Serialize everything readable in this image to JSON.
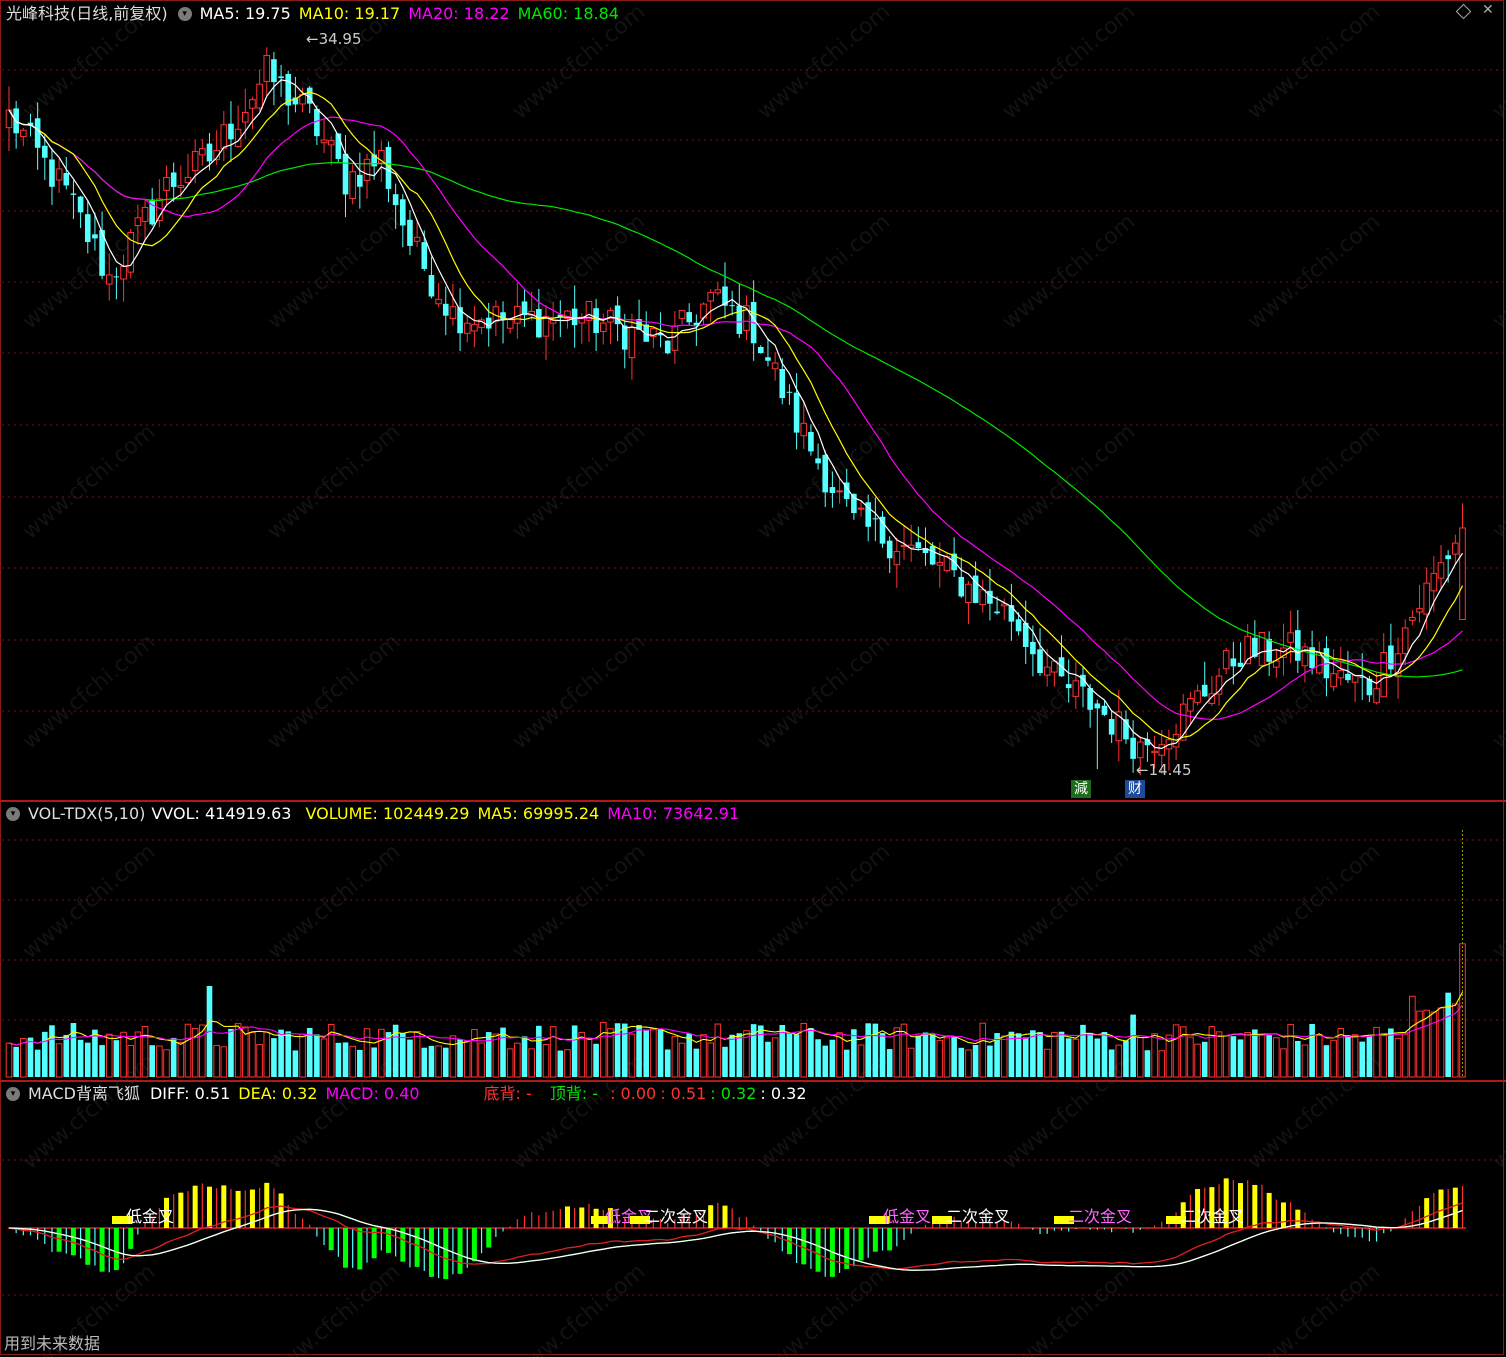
{
  "main_header": {
    "stock": "光峰科技(日线,前复权)",
    "ma5": "MA5: 19.75",
    "ma10": "MA10: 19.17",
    "ma20": "MA20: 18.22",
    "ma60": "MA60: 18.84"
  },
  "markers": {
    "high": "34.95",
    "low": "14.45",
    "tag1": "減",
    "tag2": "财"
  },
  "vol_header": {
    "name": "VOL-TDX(5,10)",
    "vvol": "VVOL: 414919.63",
    "volume": "VOLUME: 102449.29",
    "ma5": "MA5: 69995.24",
    "ma10": "MA10: 73642.91"
  },
  "macd_header": {
    "name": "MACD背离飞狐",
    "diff": "DIFF: 0.51",
    "dea": "DEA: 0.32",
    "macd": "MACD: 0.40",
    "bottom_div": "底背: -",
    "top_div": "顶背: -",
    "v1": ": 0.00",
    "v2": ": 0.51",
    "v3": ": 0.32",
    "v4": ": 0.32"
  },
  "macd_labels": [
    "低金叉",
    "低金叉",
    "二次金叉",
    "低金叉",
    "二次金叉",
    "二次金叉",
    "二次金叉"
  ],
  "footer": "用到未来数据",
  "colors": {
    "up": "#ff3232",
    "down": "#54ffff",
    "ma5": "#ffffff",
    "ma10": "#ffff00",
    "ma20": "#ff00ff",
    "ma60": "#00e600",
    "grid": "#7a1010"
  },
  "chart_data": [
    {
      "type": "candlestick",
      "title": "光峰科技(日线,前复权)",
      "ylim": [
        14.0,
        35.5
      ],
      "annotations": [
        {
          "label": "34.95",
          "kind": "high"
        },
        {
          "label": "14.45",
          "kind": "low"
        }
      ],
      "anchors": [
        [
          0,
          33.0
        ],
        [
          8,
          30.8
        ],
        [
          14,
          28.4
        ],
        [
          22,
          31.0
        ],
        [
          28,
          31.8
        ],
        [
          36,
          34.2
        ],
        [
          42,
          33.0
        ],
        [
          47,
          31.2
        ],
        [
          52,
          31.8
        ],
        [
          56,
          29.4
        ],
        [
          62,
          27.4
        ],
        [
          70,
          27.2
        ],
        [
          80,
          27.3
        ],
        [
          92,
          26.5
        ],
        [
          98,
          27.8
        ],
        [
          104,
          27.0
        ],
        [
          110,
          24.3
        ],
        [
          118,
          21.4
        ],
        [
          124,
          20.9
        ],
        [
          132,
          19.9
        ],
        [
          140,
          18.8
        ],
        [
          146,
          17.0
        ],
        [
          152,
          16.2
        ],
        [
          158,
          15.1
        ],
        [
          164,
          16.0
        ],
        [
          172,
          17.8
        ],
        [
          180,
          17.8
        ],
        [
          186,
          17.0
        ],
        [
          190,
          16.8
        ],
        [
          196,
          18.8
        ],
        [
          203,
          21.3
        ]
      ],
      "series": [
        {
          "name": "MA5",
          "value": 19.75
        },
        {
          "name": "MA10",
          "value": 19.17
        },
        {
          "name": "MA20",
          "value": 18.22
        },
        {
          "name": "MA60",
          "value": 18.84
        }
      ]
    },
    {
      "type": "bar",
      "title": "VOL-TDX(5,10)",
      "series": [
        {
          "name": "VOLUME",
          "value": 102449.29
        },
        {
          "name": "MA5",
          "value": 69995.24
        },
        {
          "name": "MA10",
          "value": 73642.91
        }
      ],
      "extra": {
        "VVOL": 414919.63
      }
    },
    {
      "type": "bar",
      "title": "MACD背离飞狐",
      "series": [
        {
          "name": "DIFF",
          "value": 0.51
        },
        {
          "name": "DEA",
          "value": 0.32
        },
        {
          "name": "MACD",
          "value": 0.4
        }
      ]
    }
  ]
}
